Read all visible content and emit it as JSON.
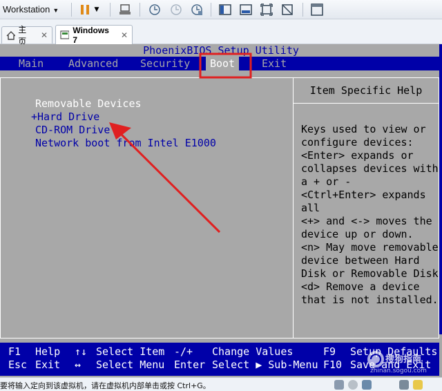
{
  "toolbar": {
    "workstation_label": "Workstation",
    "buttons": [
      {
        "name": "pause-icon"
      },
      {
        "name": "send-ctrl-alt-del-icon"
      },
      {
        "name": "snapshot-take-icon"
      },
      {
        "name": "snapshot-revert-icon"
      },
      {
        "name": "snapshot-manager-icon"
      },
      {
        "name": "view-console-icon"
      },
      {
        "name": "view-fullscreen-icon"
      },
      {
        "name": "view-unity-icon"
      },
      {
        "name": "view-stretch-icon"
      },
      {
        "name": "view-thumbnail-icon"
      }
    ]
  },
  "tabs": [
    {
      "label": "主页",
      "active": false
    },
    {
      "label": "Windows 7",
      "active": true
    }
  ],
  "bios": {
    "title": "PhoenixBIOS Setup Utility",
    "menu": [
      {
        "label": "Main",
        "selected": false
      },
      {
        "label": "Advanced",
        "selected": false
      },
      {
        "label": "Security",
        "selected": false
      },
      {
        "label": "Boot",
        "selected": true
      },
      {
        "label": "Exit",
        "selected": false
      }
    ],
    "boot_header": "Removable Devices",
    "boot_items": [
      "+Hard Drive",
      "CD-ROM Drive",
      "Network boot from Intel E1000"
    ],
    "help_title": "Item Specific Help",
    "help_lines": [
      "Keys used to view or",
      "configure devices:",
      "<Enter> expands or",
      "collapses devices with",
      "a + or -",
      "<Ctrl+Enter> expands",
      "all",
      "<+> and <-> moves the",
      "device up or down.",
      "<n> May move removable",
      "device between Hard",
      "Disk or Removable Disk",
      "<d> Remove a device",
      "that is not installed."
    ],
    "footer": {
      "row1": [
        {
          "key": "F1",
          "desc": "Help"
        },
        {
          "key": "↑↓",
          "desc": "Select Item"
        },
        {
          "key": "-/+",
          "desc": "Change Values"
        },
        {
          "key": "F9",
          "desc": "Setup Defaults"
        }
      ],
      "row2": [
        {
          "key": "Esc",
          "desc": "Exit"
        },
        {
          "key": "↔",
          "desc": "Select Menu"
        },
        {
          "key": "Enter",
          "desc": "Select ▶ Sub-Menu"
        },
        {
          "key": "F10",
          "desc": "Save and Exit"
        }
      ]
    }
  },
  "status_bar": {
    "message": "要将输入定向到该虚拟机，请在虚拟机内部单击或按 Ctrl+G。"
  },
  "watermark": {
    "text": "搜狗指南",
    "url": "zhinan.sogou.com"
  },
  "colors": {
    "bios_blue": "#0000a8",
    "bios_gray": "#a8a8a8",
    "highlight_red": "#e02020"
  }
}
